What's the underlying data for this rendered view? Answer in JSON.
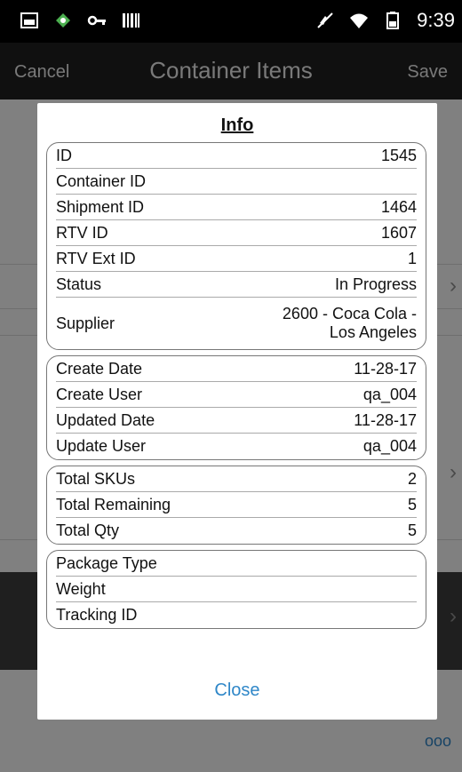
{
  "status_bar": {
    "time": "9:39",
    "left_icons": [
      "image-icon",
      "network-icon",
      "key-icon",
      "barcode-icon"
    ],
    "right_icons": [
      "mute-icon",
      "wifi-icon",
      "battery-icon"
    ]
  },
  "app_bar": {
    "cancel_label": "Cancel",
    "title": "Container Items",
    "save_label": "Save"
  },
  "background": {
    "more_label": "ooo"
  },
  "dialog": {
    "title": "Info",
    "close_label": "Close",
    "groups": [
      [
        {
          "label": "ID",
          "value": "1545"
        },
        {
          "label": "Container ID",
          "value": ""
        },
        {
          "label": "Shipment ID",
          "value": "1464"
        },
        {
          "label": "RTV ID",
          "value": "1607"
        },
        {
          "label": "RTV Ext ID",
          "value": "1"
        },
        {
          "label": "Status",
          "value": "In Progress"
        },
        {
          "label": "Supplier",
          "value": "2600 - Coca Cola -",
          "value2": "Los Angeles"
        }
      ],
      [
        {
          "label": "Create Date",
          "value": "11-28-17"
        },
        {
          "label": "Create User",
          "value": "qa_004"
        },
        {
          "label": "Updated Date",
          "value": "11-28-17"
        },
        {
          "label": "Update User",
          "value": "qa_004"
        }
      ],
      [
        {
          "label": "Total SKUs",
          "value": "2"
        },
        {
          "label": "Total Remaining",
          "value": "5"
        },
        {
          "label": "Total Qty",
          "value": "5"
        }
      ],
      [
        {
          "label": "Package Type",
          "value": ""
        },
        {
          "label": "Weight",
          "value": ""
        },
        {
          "label": "Tracking ID",
          "value": ""
        }
      ]
    ]
  },
  "colors": {
    "accent": "#2f87c8",
    "appbar": "#1e1e1e"
  }
}
